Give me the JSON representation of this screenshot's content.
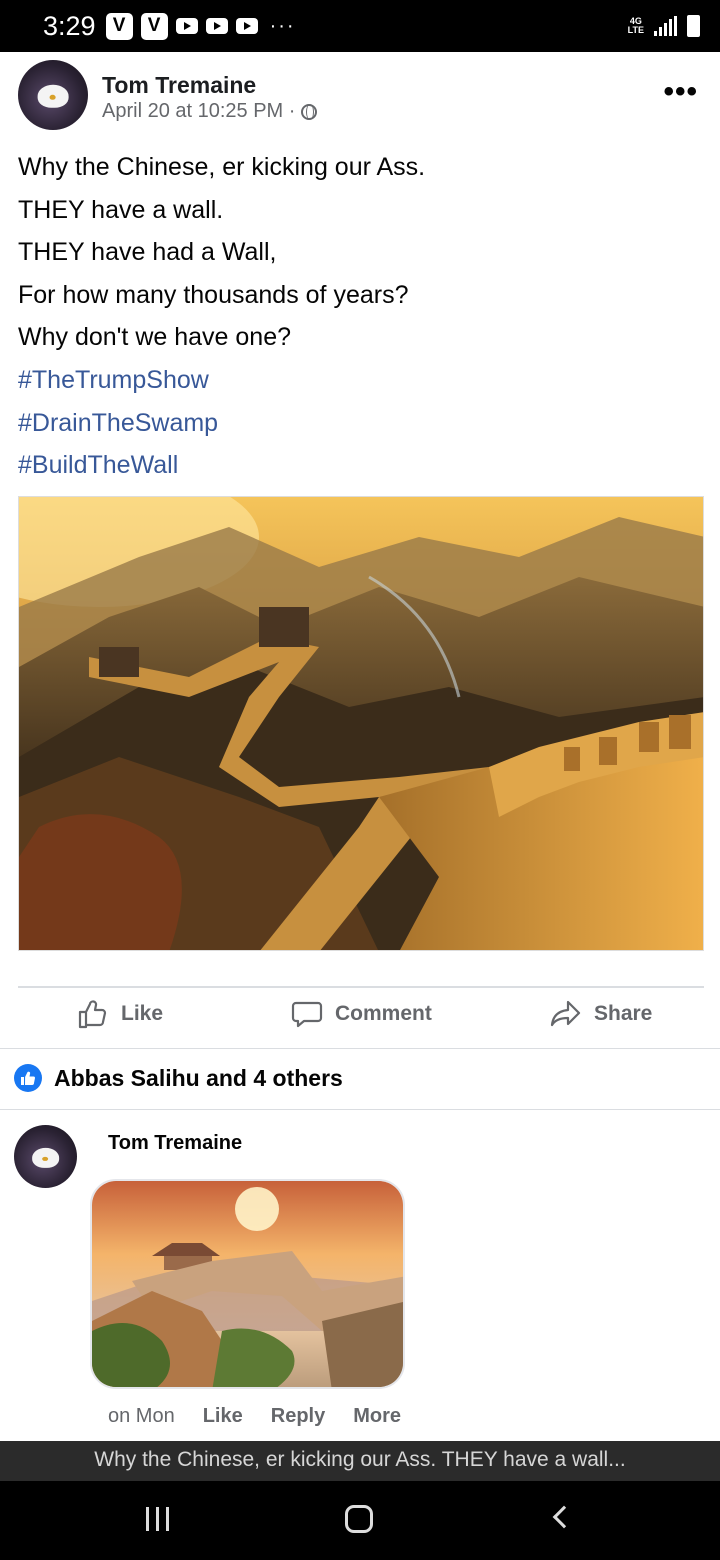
{
  "status_bar": {
    "time": "3:29",
    "app_icons": [
      "V",
      "V"
    ],
    "overflow": "···",
    "network": "4G LTE"
  },
  "post": {
    "author": "Tom Tremaine",
    "timestamp": "April 20 at 10:25 PM ·",
    "privacy_icon": "globe-icon",
    "lines": [
      "Why the Chinese, er kicking our Ass.",
      "THEY have a wall.",
      "THEY have had a Wall,",
      "For how many thousands of years?",
      "Why don't we have one?"
    ],
    "hashtags": [
      "#TheTrumpShow",
      "#DrainTheSwamp",
      "#BuildTheWall"
    ]
  },
  "actions": {
    "like": "Like",
    "comment": "Comment",
    "share": "Share"
  },
  "reactions": {
    "text": "Abbas Salihu and 4 others"
  },
  "comment": {
    "author": "Tom Tremaine",
    "time": "on Mon",
    "like": "Like",
    "reply": "Reply",
    "more": "More"
  },
  "banner": {
    "text": "Why the Chinese, er kicking our Ass. THEY have a wall..."
  },
  "colors": {
    "link": "#385898",
    "facebook_blue": "#1877f2",
    "secondary_text": "#65676b"
  }
}
